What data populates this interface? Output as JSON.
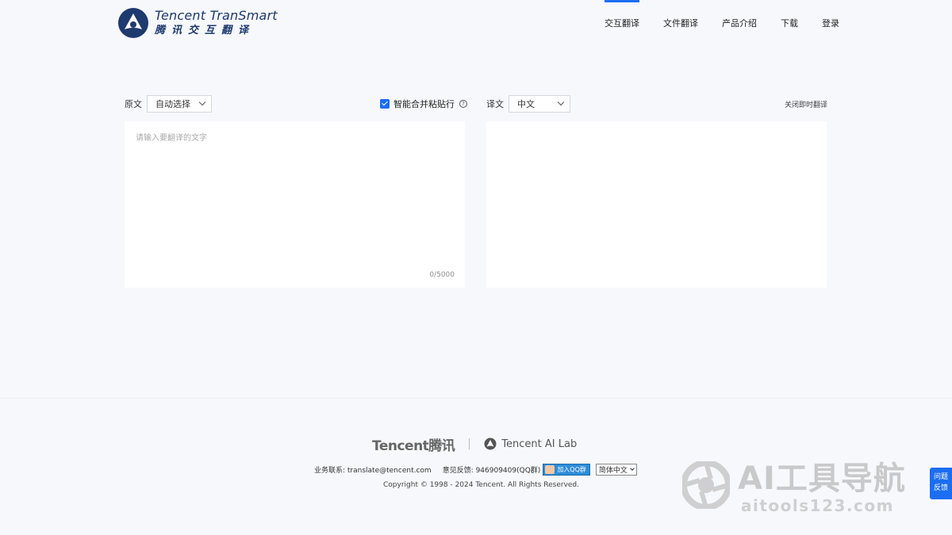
{
  "header": {
    "logo_en": "Tencent TranSmart",
    "logo_cn": "腾讯交互翻译",
    "nav": [
      {
        "label": "交互翻译",
        "active": true
      },
      {
        "label": "文件翻译",
        "active": false
      },
      {
        "label": "产品介绍",
        "active": false
      },
      {
        "label": "下载",
        "active": false
      },
      {
        "label": "登录",
        "active": false
      }
    ]
  },
  "source": {
    "label": "原文",
    "language": "自动选择",
    "placeholder": "请输入要翻译的文字",
    "value": "",
    "counter": "0/5000"
  },
  "merge_paste": {
    "label": "智能合并粘贴行",
    "checked": true,
    "help_icon": "question-circle-icon"
  },
  "target": {
    "label": "译文",
    "language": "中文",
    "close_instant": "关闭即时翻译"
  },
  "footer": {
    "brand_tencent": "Tencent腾讯",
    "brand_ailab": "Tencent AI Lab",
    "business_contact": "业务联系: translate@tencent.com",
    "feedback_qq": "意见反馈: 946909409(QQ群)",
    "join_qq": "加入QQ群",
    "language_select": "简体中文",
    "copyright": "Copyright © 1998 - 2024 Tencent. All Rights Reserved."
  },
  "watermark": {
    "title": "AI工具导航",
    "subtitle": "aitools123.com"
  },
  "side_feedback": {
    "line1": "问题",
    "line2": "反馈"
  },
  "colors": {
    "accent": "#1c6df2",
    "page_bg": "#f7f8fc",
    "logo": "#1e3a6e"
  }
}
